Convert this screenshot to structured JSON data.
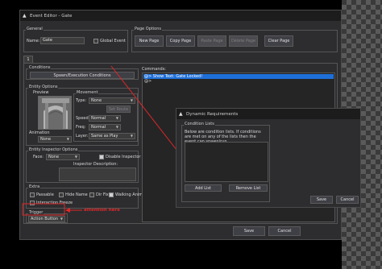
{
  "colors": {
    "background": "#000000",
    "window": "#2d2d30",
    "selection": "#1e6fd8",
    "annotation": "#e12727"
  },
  "editor": {
    "title": "Event Editor - Gate",
    "general": {
      "label": "General",
      "name_label": "Name:",
      "name_value": "Gate",
      "global_event_label": "Global Event"
    },
    "page_options": {
      "label": "Page Options",
      "new_page": "New Page",
      "copy_page": "Copy Page",
      "paste_page": "Paste Page",
      "delete_page": "Delete Page",
      "clear_page": "Clear Page"
    },
    "tab": "1",
    "conditions": {
      "label": "Conditions",
      "button": "Spawn/Execution Conditions"
    },
    "entity": {
      "label": "Entity Options",
      "preview_label": "Preview",
      "animation_label": "Animation",
      "animation_value": "None",
      "movement": {
        "label": "Movement",
        "type_label": "Type:",
        "type_value": "None",
        "set_route": "Set Route",
        "speed_label": "Speed:",
        "speed_value": "Normal",
        "freq_label": "Freq:",
        "freq_value": "Normal",
        "layer_label": "Layer:",
        "layer_value": "Same as Play"
      }
    },
    "inspector": {
      "label": "Entity Inspector Options",
      "face_label": "Face:",
      "face_value": "None",
      "disable_label": "Disable Inspector",
      "desc_label": "Inspector Description:"
    },
    "extra": {
      "label": "Extra",
      "passable": "Passable",
      "hide_name": "Hide Name",
      "dir_fix": "Dir Fix",
      "walking_anim": "Walking Anim",
      "interaction_freeze": "Interaction Freeze"
    },
    "trigger": {
      "label": "Trigger",
      "value": "Action Button"
    },
    "commands": {
      "label": "Commands:",
      "items": [
        "@> Show Text: Gate Locked!",
        "@>"
      ]
    },
    "save": "Save",
    "cancel": "Cancel"
  },
  "annotation": {
    "text": "attention here"
  },
  "dynamic": {
    "title": "Dynamic Requirements",
    "condition_lists_label": "Condition Lists",
    "desc": "Below are condition lists. If conditions are met on any of the lists then the event can spawn/run.",
    "add_list": "Add List",
    "remove_list": "Remove List",
    "save": "Save",
    "cancel": "Cancel"
  },
  "icons": {
    "app": "intersect-logo-icon",
    "dropdown": "chevron-down-icon",
    "close": "close-icon"
  }
}
